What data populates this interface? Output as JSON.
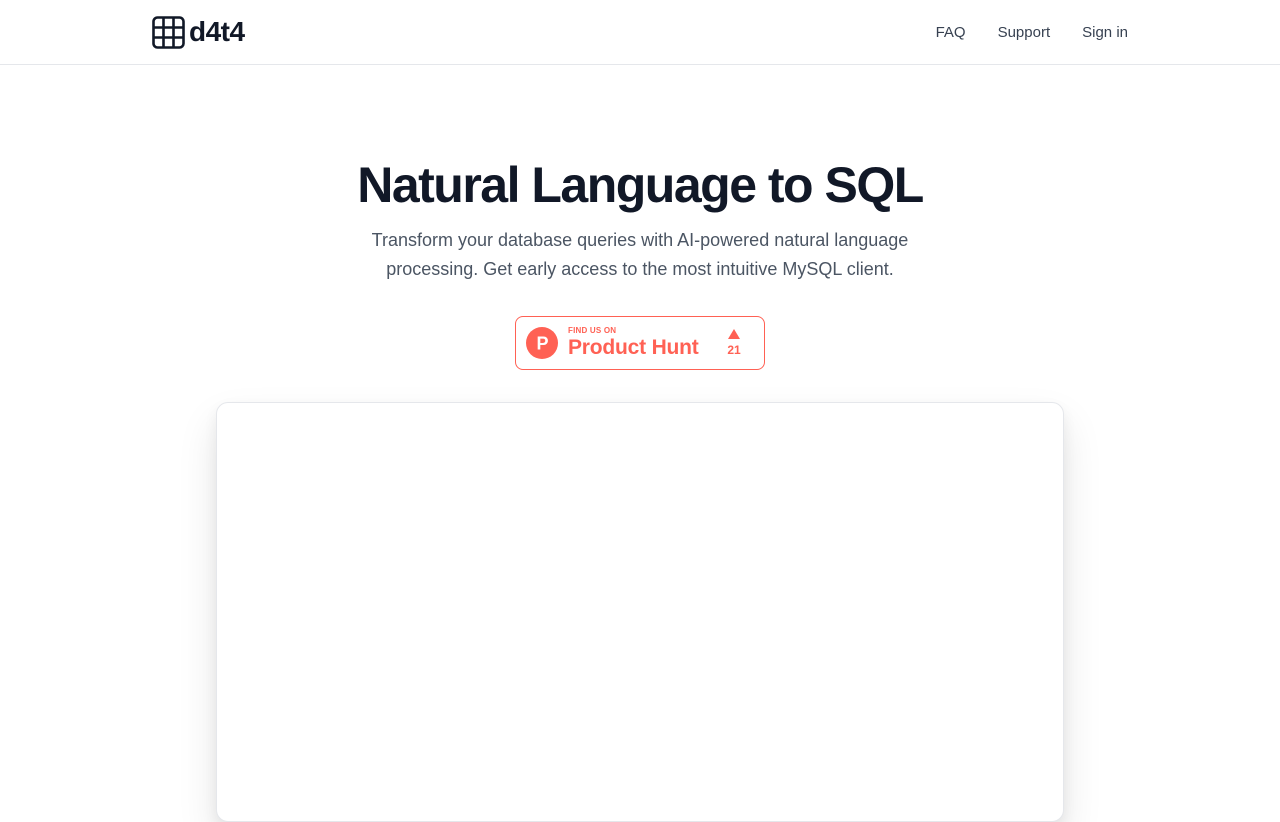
{
  "header": {
    "brand": {
      "name": "d4t4",
      "icon": "table-grid-icon"
    },
    "nav": [
      {
        "label": "FAQ"
      },
      {
        "label": "Support"
      },
      {
        "label": "Sign in"
      }
    ]
  },
  "hero": {
    "title": "Natural Language to SQL",
    "subtitle": "Transform your database queries with AI-powered natural language processing. Get early access to the most intuitive MySQL client."
  },
  "product_hunt_badge": {
    "top_text": "FIND US ON",
    "main_text": "Product Hunt",
    "votes": "21",
    "logo_letter": "P",
    "accent_color": "#ff6154",
    "icon": "upvote-arrow-icon"
  },
  "preview": {
    "content": ""
  },
  "colors": {
    "text_primary": "#111827",
    "text_secondary": "#4b5563",
    "border": "#e5e7eb"
  }
}
